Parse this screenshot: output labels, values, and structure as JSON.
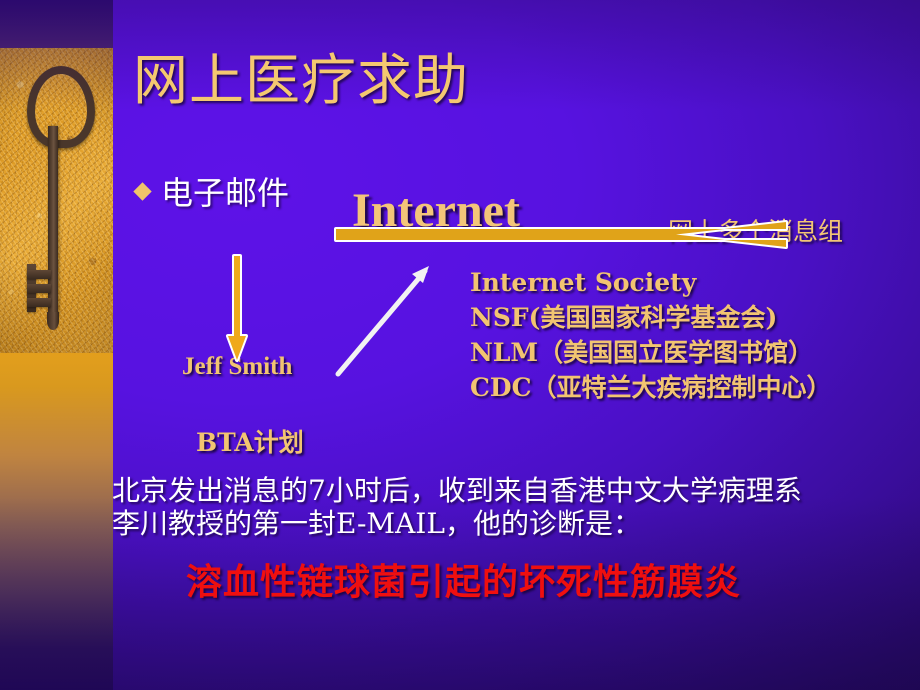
{
  "slide": {
    "title": "网上医疗求助",
    "bullet": {
      "marker": "diamond-bullet",
      "text": "电子邮件"
    },
    "internet_label": "Internet",
    "newsgroups_label": "网上多个消息组",
    "organizations": [
      "Internet Society",
      "NSF(美国国家科学基金会)",
      "NLM（美国国立医学图书馆）",
      "CDC（亚特兰大疾病控制中心）"
    ],
    "person_label": "Jeff Smith",
    "program_label": "BTA计划",
    "narrative": [
      "北京发出消息的7小时后，收到来自香港中文大学病理系",
      "李川教授的第一封E-MAIL，他的诊断是："
    ],
    "diagnosis": "溶血性链球菌引起的坏死性筋膜炎",
    "sidebar": {
      "image_name": "antique-key-photo"
    },
    "arrows": {
      "internet_to_newsgroups": "horizontal-gold-arrow",
      "internet_to_person": "downward-gold-arrow",
      "person_to_organizations": "diagonal-white-arrow"
    },
    "colors": {
      "background_violet": "#5712e0",
      "background_deep": "#1f0750",
      "gold_text": "#f2c471",
      "white_text": "#ffffff",
      "diagnosis_red": "#ef0f0f",
      "sidebar_amber": "#e5a01c"
    }
  }
}
